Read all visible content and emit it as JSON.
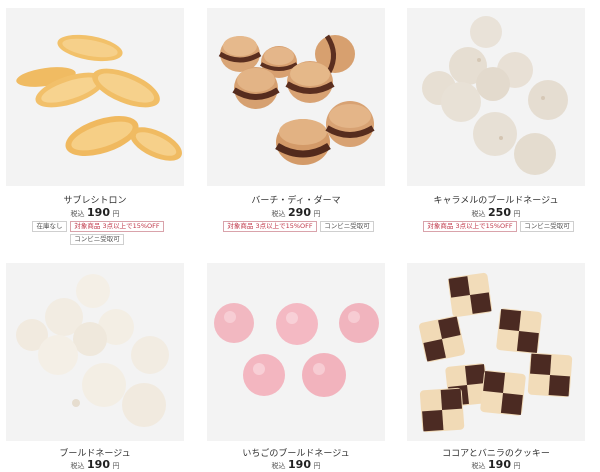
{
  "products": [
    {
      "name": "サブレシトロン",
      "price_prefix": "税込",
      "price": "190",
      "price_suffix": "円",
      "tags": [
        "在庫なし",
        "対象商品 3点以上で15%OFF",
        "コンビニ受取可"
      ],
      "image": "lemon-sable-cookies"
    },
    {
      "name": "バーチ・ディ・ダーマ",
      "price_prefix": "税込",
      "price": "290",
      "price_suffix": "円",
      "tags": [
        "対象商品 3点以上で15%OFF",
        "コンビニ受取可"
      ],
      "image": "baci-di-dama-cookies"
    },
    {
      "name": "キャラメルのブールドネージュ",
      "price_prefix": "税込",
      "price": "250",
      "price_suffix": "円",
      "tags": [
        "対象商品 3点以上で15%OFF",
        "コンビニ受取可"
      ],
      "image": "caramel-snowball-cookies"
    },
    {
      "name": "ブールドネージュ",
      "price_prefix": "税込",
      "price": "190",
      "price_suffix": "円",
      "tags": [],
      "image": "snowball-cookies"
    },
    {
      "name": "いちごのブールドネージュ",
      "price_prefix": "税込",
      "price": "190",
      "price_suffix": "円",
      "tags": [],
      "image": "strawberry-snowball-cookies"
    },
    {
      "name": "ココアとバニラのクッキー",
      "price_prefix": "税込",
      "price": "190",
      "price_suffix": "円",
      "tags": [],
      "image": "checkerboard-cookies"
    }
  ],
  "colors": {
    "sale_tag": "#c0394b",
    "photo_bg": "#f3f3f3"
  }
}
